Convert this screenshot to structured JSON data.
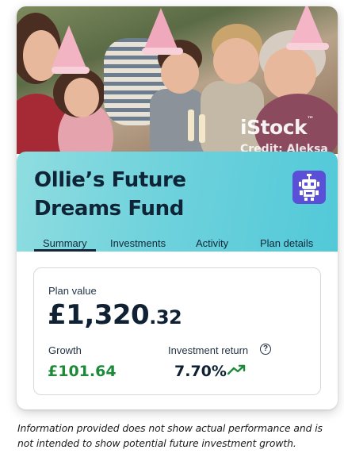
{
  "photo": {
    "watermark": "iStock",
    "credit": "Credit: Aleksa"
  },
  "fund": {
    "title": "Ollie’s Future Dreams Fund",
    "avatar_icon": "robot-icon"
  },
  "tabs": [
    {
      "label": "Summary",
      "active": true
    },
    {
      "label": "Investments",
      "active": false
    },
    {
      "label": "Activity",
      "active": false
    },
    {
      "label": "Plan details",
      "active": false
    }
  ],
  "summary": {
    "plan_value_label": "Plan value",
    "plan_value_main": "£1,320",
    "plan_value_pence": ".32",
    "growth_label": "Growth",
    "growth_value": "£101.64",
    "return_label": "Investment return",
    "return_value": "7.70%",
    "return_trend_icon": "trending-up-icon",
    "help_icon": "help-icon"
  },
  "disclaimer": "Information provided does not show actual performance and is not intended to show potential future investment growth.",
  "colors": {
    "header_gradient_start": "#8fdde0",
    "header_gradient_end": "#52c9d8",
    "avatar_background": "#5b4fd8",
    "growth_green": "#1d8a3a",
    "text_navy": "#0f2133"
  }
}
